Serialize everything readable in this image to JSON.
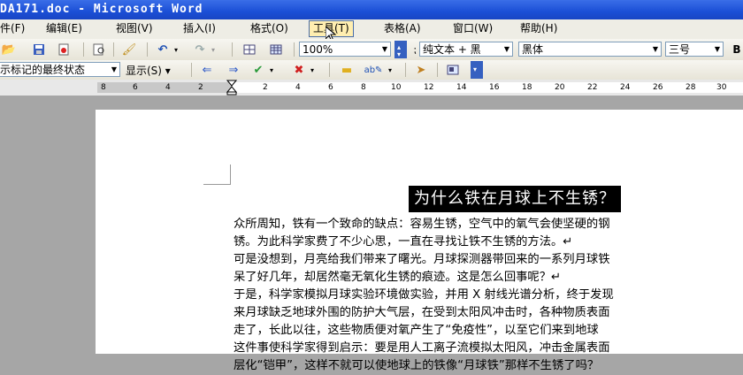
{
  "window": {
    "title": "DA171.doc - Microsoft Word"
  },
  "menu": [
    "件(F)",
    "编辑(E)",
    "视图(V)",
    "插入(I)",
    "格式(O)",
    "工具(T)",
    "表格(A)",
    "窗口(W)",
    "帮助(H)"
  ],
  "toolbar1": {
    "zoom": "100%",
    "style": "纯文本 + 黑",
    "font": "黑体",
    "font_size": "三号"
  },
  "toolbar2": {
    "markup_state": "示标记的最终状态",
    "show_label": "显示(S)"
  },
  "ruler": {
    "numbers": [
      "8",
      "6",
      "4",
      "2",
      "2",
      "4",
      "6",
      "8",
      "10",
      "12",
      "14",
      "16",
      "18",
      "20",
      "22",
      "24",
      "26",
      "28",
      "30",
      "32"
    ]
  },
  "document": {
    "heading": "为什么铁在月球上不生锈？",
    "lines": [
      "众所周知，铁有一个致命的缺点：容易生锈，空气中的氧气会使坚硬的钢",
      "锈。为此科学家费了不少心思，一直在寻找让铁不生锈的方法。↵",
      "可是没想到，月亮给我们带来了曙光。月球探测器带回来的一系列月球铁",
      "呆了好几年，却居然毫无氧化生锈的痕迹。这是怎么回事呢？↵",
      "于是，科学家模拟月球实验环境做实验，并用 X 射线光谱分析，终于发现",
      "来月球缺乏地球外围的防护大气层，在受到太阳风冲击时，各种物质表面",
      "走了，长此以往，这些物质便对氧产生了“免疫性”，以至它们来到地球",
      "这件事使科学家得到启示：要是用人工离子流模拟太阳风，冲击金属表面",
      "层化“铠甲”，这样不就可以使地球上的铁像“月球铁”那样不生锈了吗？"
    ]
  }
}
